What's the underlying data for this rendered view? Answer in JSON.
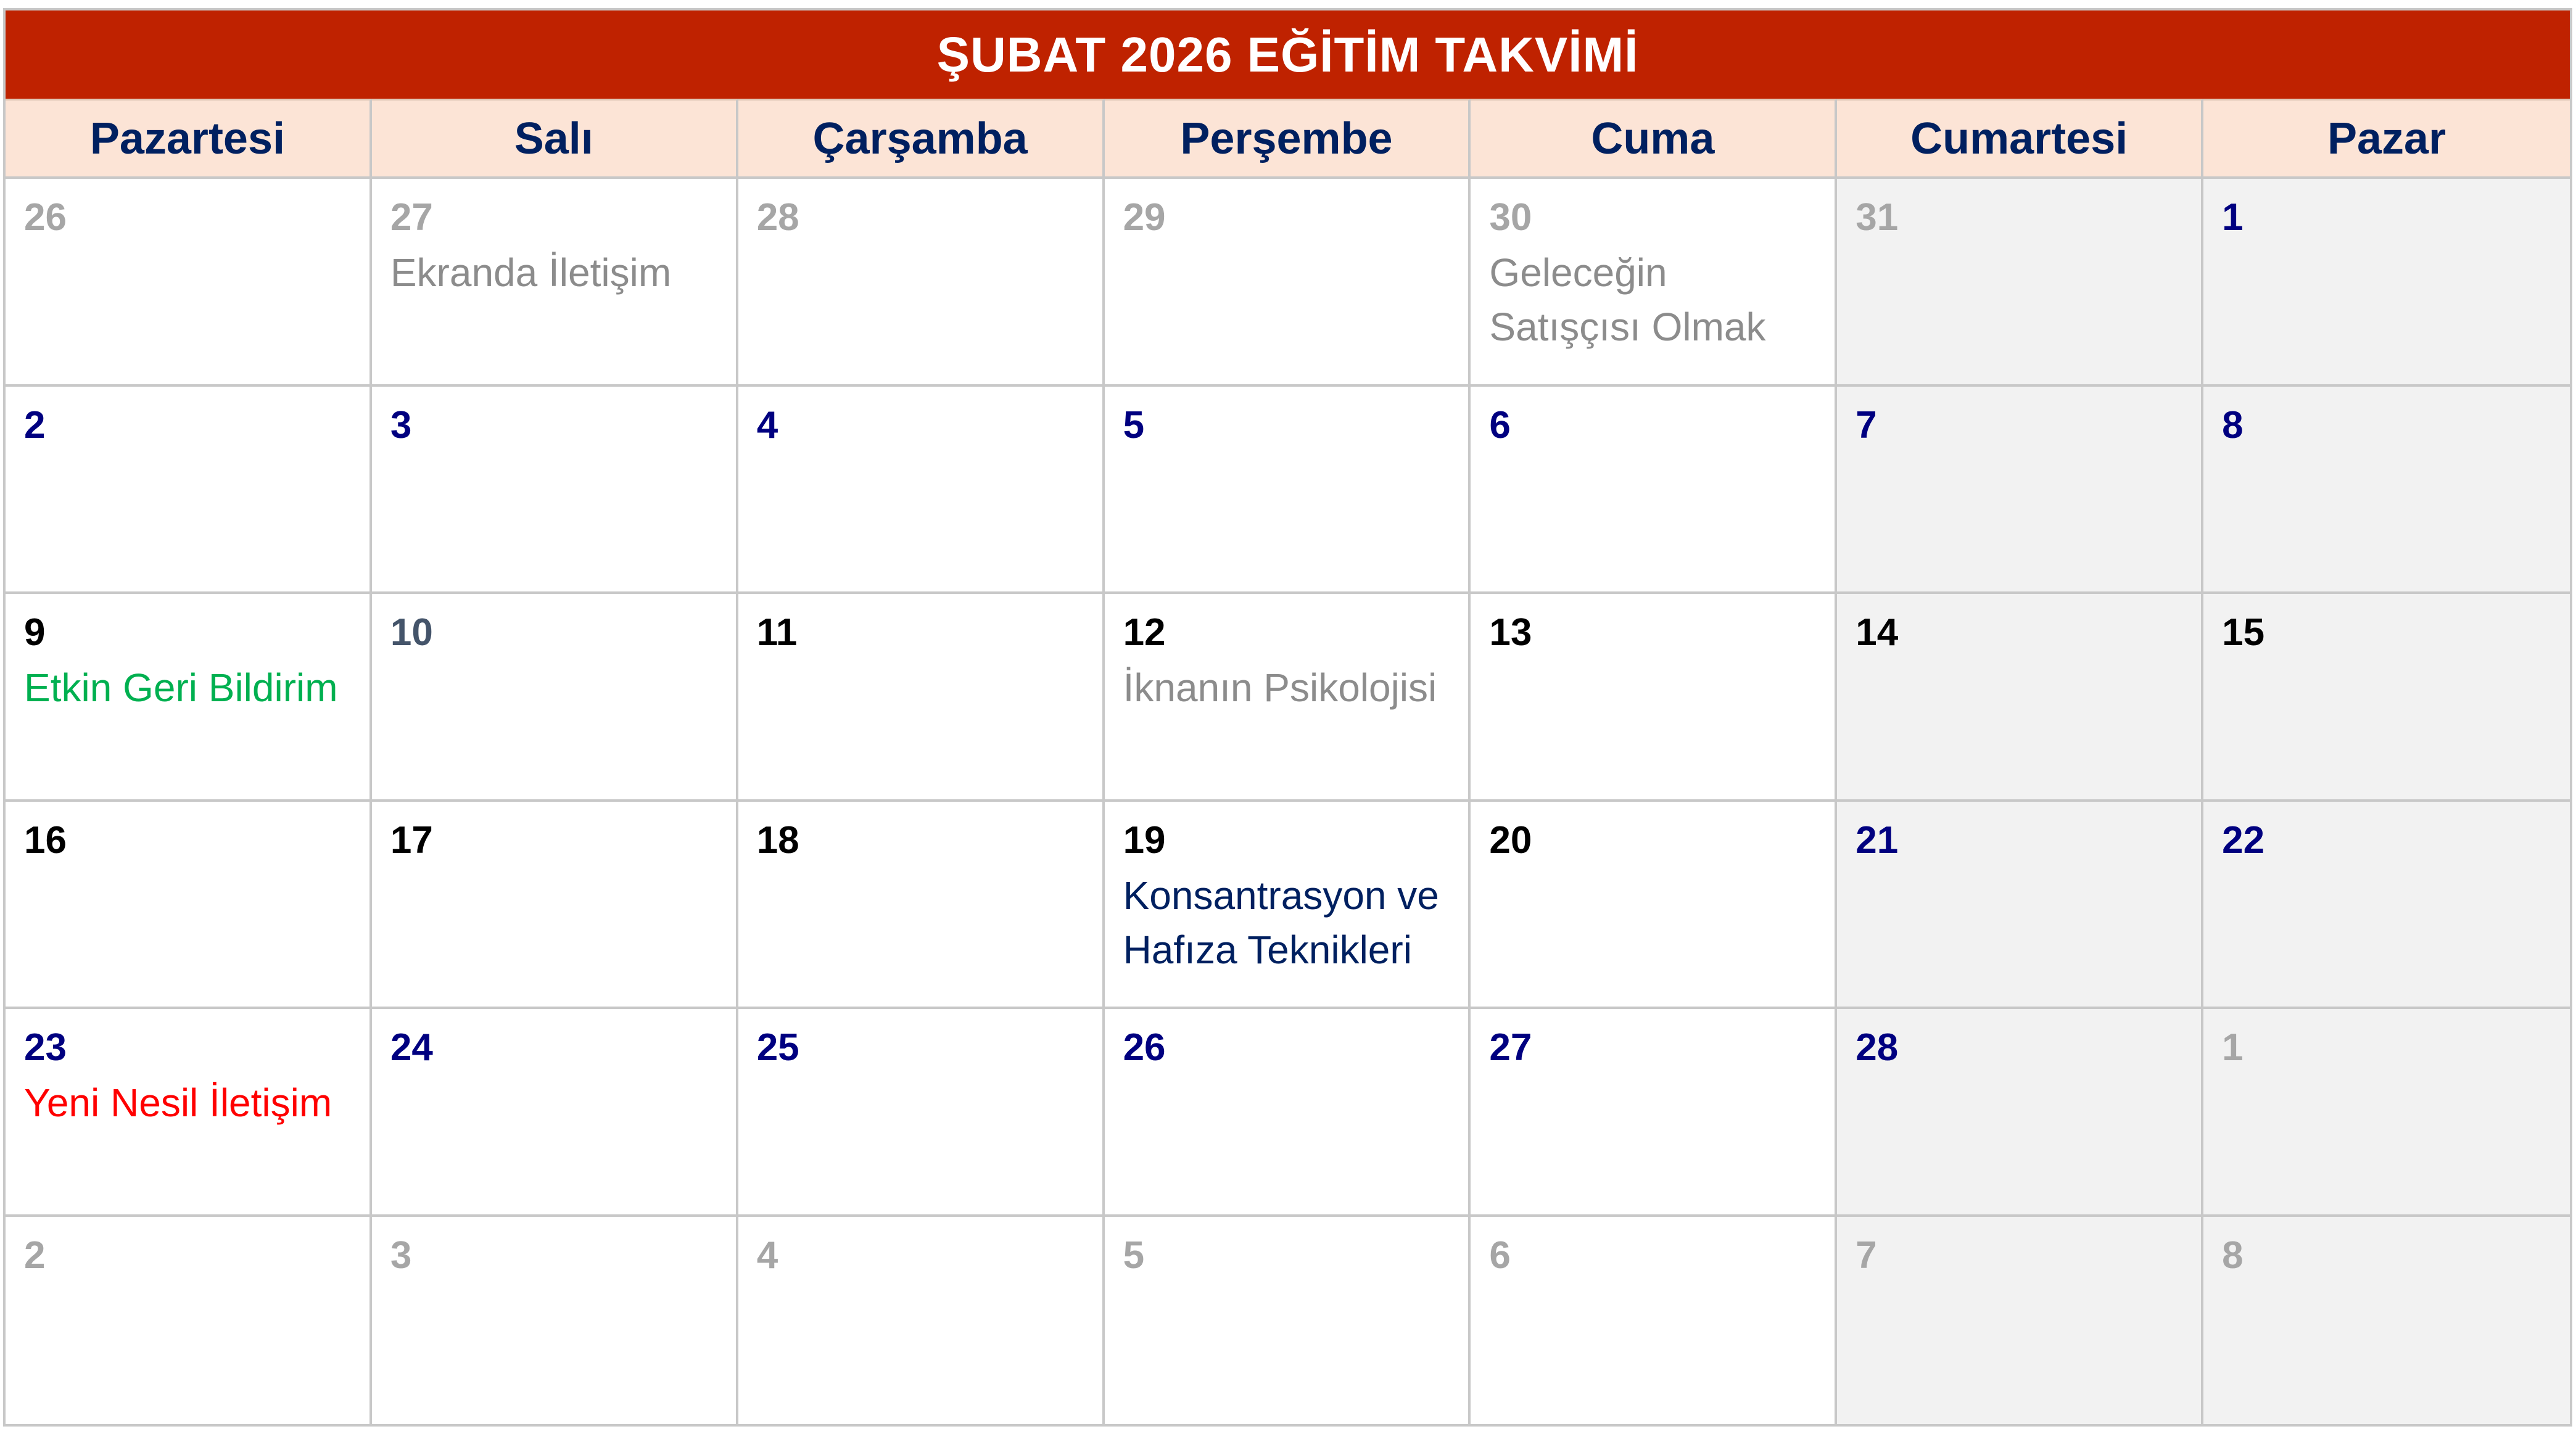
{
  "title": "ŞUBAT 2026 EĞİTİM TAKVİMİ",
  "colors": {
    "title_bg": "#bf2200",
    "header_bg": "#fce4d6",
    "header_text": "#002060",
    "weekend_bg": "#f2f2f2",
    "grid_line": "#c8c8c8"
  },
  "weekdays": [
    "Pazartesi",
    "Salı",
    "Çarşamba",
    "Perşembe",
    "Cuma",
    "Cumartesi",
    "Pazar"
  ],
  "weeks": [
    [
      {
        "day": "26",
        "event": ""
      },
      {
        "day": "27",
        "event": "Ekranda İletişim"
      },
      {
        "day": "28",
        "event": ""
      },
      {
        "day": "29",
        "event": ""
      },
      {
        "day": "30",
        "event": "Geleceğin Satışçısı Olmak"
      },
      {
        "day": "31",
        "event": ""
      },
      {
        "day": "1",
        "event": ""
      }
    ],
    [
      {
        "day": "2",
        "event": ""
      },
      {
        "day": "3",
        "event": ""
      },
      {
        "day": "4",
        "event": ""
      },
      {
        "day": "5",
        "event": ""
      },
      {
        "day": "6",
        "event": ""
      },
      {
        "day": "7",
        "event": ""
      },
      {
        "day": "8",
        "event": ""
      }
    ],
    [
      {
        "day": "9",
        "event": "Etkin Geri Bildirim"
      },
      {
        "day": "10",
        "event": ""
      },
      {
        "day": "11",
        "event": ""
      },
      {
        "day": "12",
        "event": "İknanın Psikolojisi"
      },
      {
        "day": "13",
        "event": ""
      },
      {
        "day": "14",
        "event": ""
      },
      {
        "day": "15",
        "event": ""
      }
    ],
    [
      {
        "day": "16",
        "event": ""
      },
      {
        "day": "17",
        "event": ""
      },
      {
        "day": "18",
        "event": ""
      },
      {
        "day": "19",
        "event": "Konsantrasyon ve Hafıza Teknikleri"
      },
      {
        "day": "20",
        "event": ""
      },
      {
        "day": "21",
        "event": ""
      },
      {
        "day": "22",
        "event": ""
      }
    ],
    [
      {
        "day": "23",
        "event": "Yeni Nesil İletişim"
      },
      {
        "day": "24",
        "event": ""
      },
      {
        "day": "25",
        "event": ""
      },
      {
        "day": "26",
        "event": ""
      },
      {
        "day": "27",
        "event": ""
      },
      {
        "day": "28",
        "event": ""
      },
      {
        "day": "1",
        "event": ""
      }
    ],
    [
      {
        "day": "2",
        "event": ""
      },
      {
        "day": "3",
        "event": ""
      },
      {
        "day": "4",
        "event": ""
      },
      {
        "day": "5",
        "event": ""
      },
      {
        "day": "6",
        "event": ""
      },
      {
        "day": "7",
        "event": ""
      },
      {
        "day": "8",
        "event": ""
      }
    ]
  ]
}
